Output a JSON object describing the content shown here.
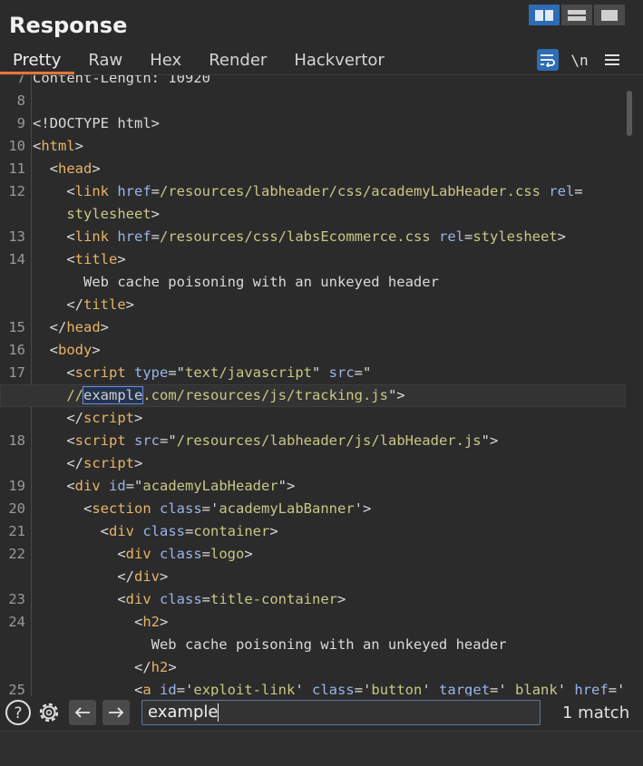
{
  "panel": {
    "title": "Response"
  },
  "tabs": [
    "Pretty",
    "Raw",
    "Hex",
    "Render",
    "Hackvertor"
  ],
  "active_tab": "Pretty",
  "tools": {
    "newline_label": "\\n"
  },
  "lines": [
    {
      "ln": "7",
      "tokens": [
        {
          "t": "Content-Length: 10920",
          "c": "text"
        }
      ]
    },
    {
      "ln": "8",
      "tokens": []
    },
    {
      "ln": "9",
      "tokens": [
        {
          "t": "<!DOCTYPE html>",
          "c": "text"
        }
      ]
    },
    {
      "ln": "10",
      "tokens": [
        {
          "t": "<",
          "c": "text"
        },
        {
          "t": "html",
          "c": "tag"
        },
        {
          "t": ">",
          "c": "text"
        }
      ]
    },
    {
      "ln": "11",
      "tokens": [
        {
          "t": "  <",
          "c": "text"
        },
        {
          "t": "head",
          "c": "tag"
        },
        {
          "t": ">",
          "c": "text"
        }
      ]
    },
    {
      "ln": "12",
      "tokens": [
        {
          "t": "    <",
          "c": "text"
        },
        {
          "t": "link",
          "c": "tag"
        },
        {
          "t": " ",
          "c": "text"
        },
        {
          "t": "href",
          "c": "attr"
        },
        {
          "t": "=",
          "c": "text"
        },
        {
          "t": "/resources/labheader/css/academyLabHeader.css",
          "c": "val"
        },
        {
          "t": " ",
          "c": "text"
        },
        {
          "t": "rel",
          "c": "attr"
        },
        {
          "t": "=",
          "c": "text"
        }
      ]
    },
    {
      "ln": "",
      "tokens": [
        {
          "t": "    ",
          "c": "text"
        },
        {
          "t": "stylesheet",
          "c": "val"
        },
        {
          "t": ">",
          "c": "text"
        }
      ]
    },
    {
      "ln": "13",
      "tokens": [
        {
          "t": "    <",
          "c": "text"
        },
        {
          "t": "link",
          "c": "tag"
        },
        {
          "t": " ",
          "c": "text"
        },
        {
          "t": "href",
          "c": "attr"
        },
        {
          "t": "=",
          "c": "text"
        },
        {
          "t": "/resources/css/labsEcommerce.css",
          "c": "val"
        },
        {
          "t": " ",
          "c": "text"
        },
        {
          "t": "rel",
          "c": "attr"
        },
        {
          "t": "=",
          "c": "text"
        },
        {
          "t": "stylesheet",
          "c": "val"
        },
        {
          "t": ">",
          "c": "text"
        }
      ]
    },
    {
      "ln": "14",
      "tokens": [
        {
          "t": "    <",
          "c": "text"
        },
        {
          "t": "title",
          "c": "tag"
        },
        {
          "t": ">",
          "c": "text"
        }
      ]
    },
    {
      "ln": "",
      "tokens": [
        {
          "t": "      Web cache poisoning with an unkeyed header",
          "c": "text"
        }
      ]
    },
    {
      "ln": "",
      "tokens": [
        {
          "t": "    </",
          "c": "text"
        },
        {
          "t": "title",
          "c": "tag"
        },
        {
          "t": ">",
          "c": "text"
        }
      ]
    },
    {
      "ln": "15",
      "tokens": [
        {
          "t": "  </",
          "c": "text"
        },
        {
          "t": "head",
          "c": "tag"
        },
        {
          "t": ">",
          "c": "text"
        }
      ]
    },
    {
      "ln": "16",
      "tokens": [
        {
          "t": "  <",
          "c": "text"
        },
        {
          "t": "body",
          "c": "tag"
        },
        {
          "t": ">",
          "c": "text"
        }
      ]
    },
    {
      "ln": "17",
      "tokens": [
        {
          "t": "    <",
          "c": "text"
        },
        {
          "t": "script",
          "c": "tag"
        },
        {
          "t": " ",
          "c": "text"
        },
        {
          "t": "type",
          "c": "attr"
        },
        {
          "t": "=\"",
          "c": "text"
        },
        {
          "t": "text/javascript",
          "c": "val"
        },
        {
          "t": "\" ",
          "c": "text"
        },
        {
          "t": "src",
          "c": "attr"
        },
        {
          "t": "=\"",
          "c": "text"
        }
      ]
    },
    {
      "ln": "",
      "hl": true,
      "tokens": [
        {
          "t": "    //",
          "c": "val"
        },
        {
          "t": "example",
          "c": "match"
        },
        {
          "t": ".com/resources/js/tracking.js",
          "c": "val"
        },
        {
          "t": "\">",
          "c": "text"
        }
      ]
    },
    {
      "ln": "",
      "tokens": [
        {
          "t": "    </",
          "c": "text"
        },
        {
          "t": "script",
          "c": "tag"
        },
        {
          "t": ">",
          "c": "text"
        }
      ]
    },
    {
      "ln": "18",
      "tokens": [
        {
          "t": "    <",
          "c": "text"
        },
        {
          "t": "script",
          "c": "tag"
        },
        {
          "t": " ",
          "c": "text"
        },
        {
          "t": "src",
          "c": "attr"
        },
        {
          "t": "=\"",
          "c": "text"
        },
        {
          "t": "/resources/labheader/js/labHeader.js",
          "c": "val"
        },
        {
          "t": "\">",
          "c": "text"
        }
      ]
    },
    {
      "ln": "",
      "tokens": [
        {
          "t": "    </",
          "c": "text"
        },
        {
          "t": "script",
          "c": "tag"
        },
        {
          "t": ">",
          "c": "text"
        }
      ]
    },
    {
      "ln": "19",
      "tokens": [
        {
          "t": "    <",
          "c": "text"
        },
        {
          "t": "div",
          "c": "tag"
        },
        {
          "t": " ",
          "c": "text"
        },
        {
          "t": "id",
          "c": "attr"
        },
        {
          "t": "=\"",
          "c": "text"
        },
        {
          "t": "academyLabHeader",
          "c": "val"
        },
        {
          "t": "\">",
          "c": "text"
        }
      ]
    },
    {
      "ln": "20",
      "tokens": [
        {
          "t": "      <",
          "c": "text"
        },
        {
          "t": "section",
          "c": "tag"
        },
        {
          "t": " ",
          "c": "text"
        },
        {
          "t": "class",
          "c": "attr"
        },
        {
          "t": "='",
          "c": "text"
        },
        {
          "t": "academyLabBanner",
          "c": "val"
        },
        {
          "t": "'>",
          "c": "text"
        }
      ]
    },
    {
      "ln": "21",
      "tokens": [
        {
          "t": "        <",
          "c": "text"
        },
        {
          "t": "div",
          "c": "tag"
        },
        {
          "t": " ",
          "c": "text"
        },
        {
          "t": "class",
          "c": "attr"
        },
        {
          "t": "=",
          "c": "text"
        },
        {
          "t": "container",
          "c": "val"
        },
        {
          "t": ">",
          "c": "text"
        }
      ]
    },
    {
      "ln": "22",
      "tokens": [
        {
          "t": "          <",
          "c": "text"
        },
        {
          "t": "div",
          "c": "tag"
        },
        {
          "t": " ",
          "c": "text"
        },
        {
          "t": "class",
          "c": "attr"
        },
        {
          "t": "=",
          "c": "text"
        },
        {
          "t": "logo",
          "c": "val"
        },
        {
          "t": ">",
          "c": "text"
        }
      ]
    },
    {
      "ln": "",
      "tokens": [
        {
          "t": "          </",
          "c": "text"
        },
        {
          "t": "div",
          "c": "tag"
        },
        {
          "t": ">",
          "c": "text"
        }
      ]
    },
    {
      "ln": "23",
      "tokens": [
        {
          "t": "          <",
          "c": "text"
        },
        {
          "t": "div",
          "c": "tag"
        },
        {
          "t": " ",
          "c": "text"
        },
        {
          "t": "class",
          "c": "attr"
        },
        {
          "t": "=",
          "c": "text"
        },
        {
          "t": "title-container",
          "c": "val"
        },
        {
          "t": ">",
          "c": "text"
        }
      ]
    },
    {
      "ln": "24",
      "tokens": [
        {
          "t": "            <",
          "c": "text"
        },
        {
          "t": "h2",
          "c": "tag"
        },
        {
          "t": ">",
          "c": "text"
        }
      ]
    },
    {
      "ln": "",
      "tokens": [
        {
          "t": "              Web cache poisoning with an unkeyed header",
          "c": "text"
        }
      ]
    },
    {
      "ln": "",
      "tokens": [
        {
          "t": "            </",
          "c": "text"
        },
        {
          "t": "h2",
          "c": "tag"
        },
        {
          "t": ">",
          "c": "text"
        }
      ]
    },
    {
      "ln": "25",
      "tokens": [
        {
          "t": "            <",
          "c": "text"
        },
        {
          "t": "a",
          "c": "tag"
        },
        {
          "t": " ",
          "c": "text"
        },
        {
          "t": "id",
          "c": "attr"
        },
        {
          "t": "='",
          "c": "text"
        },
        {
          "t": "exploit-link",
          "c": "val"
        },
        {
          "t": "' ",
          "c": "text"
        },
        {
          "t": "class",
          "c": "attr"
        },
        {
          "t": "='",
          "c": "text"
        },
        {
          "t": "button",
          "c": "val"
        },
        {
          "t": "' ",
          "c": "text"
        },
        {
          "t": "target",
          "c": "attr"
        },
        {
          "t": "='",
          "c": "text"
        },
        {
          "t": "_blank",
          "c": "val"
        },
        {
          "t": "' ",
          "c": "text"
        },
        {
          "t": "href",
          "c": "attr"
        },
        {
          "t": "='",
          "c": "text"
        }
      ]
    }
  ],
  "search": {
    "value": "example",
    "matches": "1 match"
  }
}
